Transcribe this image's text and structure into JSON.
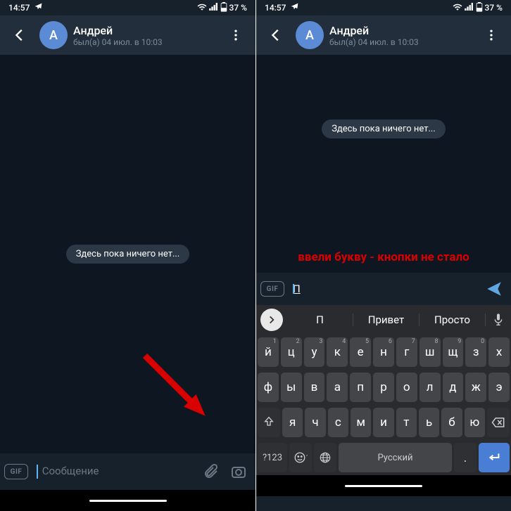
{
  "status": {
    "time": "14:57",
    "battery": "37 %"
  },
  "header": {
    "avatar_letter": "А",
    "contact_name": "Андрей",
    "contact_status": "был(а) 04 июл. в 10:03"
  },
  "chat": {
    "empty": "Здесь пока ничего нет..."
  },
  "left": {
    "input_placeholder": "Сообщение",
    "gif": "GIF"
  },
  "right": {
    "annotation": "ввели букву - кнопки не стало",
    "gif": "GIF",
    "typed": "П",
    "suggestions": [
      "П",
      "Привет",
      "Просто"
    ],
    "keyboard": {
      "row1": [
        "й",
        "ц",
        "у",
        "к",
        "е",
        "н",
        "г",
        "ш",
        "щ",
        "з",
        "х"
      ],
      "row1_hints": [
        "1",
        "2",
        "3",
        "4",
        "5",
        "6",
        "7",
        "8",
        "9",
        "0",
        ""
      ],
      "row2": [
        "ф",
        "ы",
        "в",
        "а",
        "п",
        "р",
        "о",
        "л",
        "д",
        "ж",
        "э"
      ],
      "row3": [
        "я",
        "ч",
        "с",
        "м",
        "и",
        "т",
        "ь",
        "б",
        "ю"
      ],
      "num": "?123",
      "lang_label": "Русский",
      "comma": ","
    }
  }
}
